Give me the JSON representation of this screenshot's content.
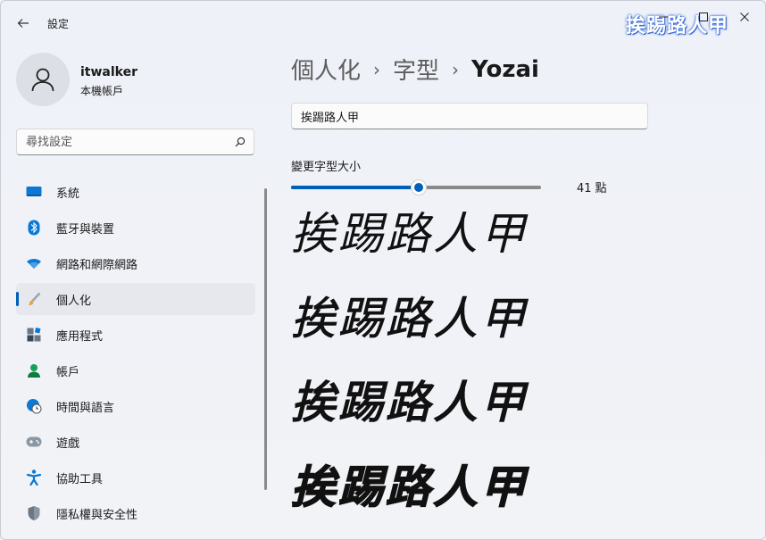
{
  "window": {
    "title": "設定",
    "controls": {
      "minimize": "—",
      "maximize": "☐",
      "close": "✕"
    },
    "watermark": "挨踢路人甲"
  },
  "user": {
    "name": "itwalker",
    "account_type": "本機帳戶"
  },
  "search": {
    "placeholder": "尋找設定"
  },
  "sidebar": {
    "items": [
      {
        "label": "系統",
        "icon": "display-icon",
        "active": false
      },
      {
        "label": "藍牙與裝置",
        "icon": "bluetooth-icon",
        "active": false
      },
      {
        "label": "網路和網際網路",
        "icon": "wifi-icon",
        "active": false
      },
      {
        "label": "個人化",
        "icon": "brush-icon",
        "active": true
      },
      {
        "label": "應用程式",
        "icon": "apps-icon",
        "active": false
      },
      {
        "label": "帳戶",
        "icon": "person-icon",
        "active": false
      },
      {
        "label": "時間與語言",
        "icon": "globe-clock-icon",
        "active": false
      },
      {
        "label": "遊戲",
        "icon": "gamepad-icon",
        "active": false
      },
      {
        "label": "協助工具",
        "icon": "accessibility-icon",
        "active": false
      },
      {
        "label": "隱私權與安全性",
        "icon": "shield-icon",
        "active": false
      }
    ]
  },
  "breadcrumb": {
    "level1": "個人化",
    "level2": "字型",
    "current": "Yozai"
  },
  "preview": {
    "text": "挨踢路人甲"
  },
  "font_size": {
    "label": "變更字型大小",
    "value_text": "41 點",
    "slider_fraction": 0.51
  },
  "samples": [
    "挨踢路人甲",
    "挨踢路人甲",
    "挨踢路人甲",
    "挨踢路人甲"
  ],
  "colors": {
    "accent": "#005fb8",
    "watermark": "#3a6fd8"
  }
}
